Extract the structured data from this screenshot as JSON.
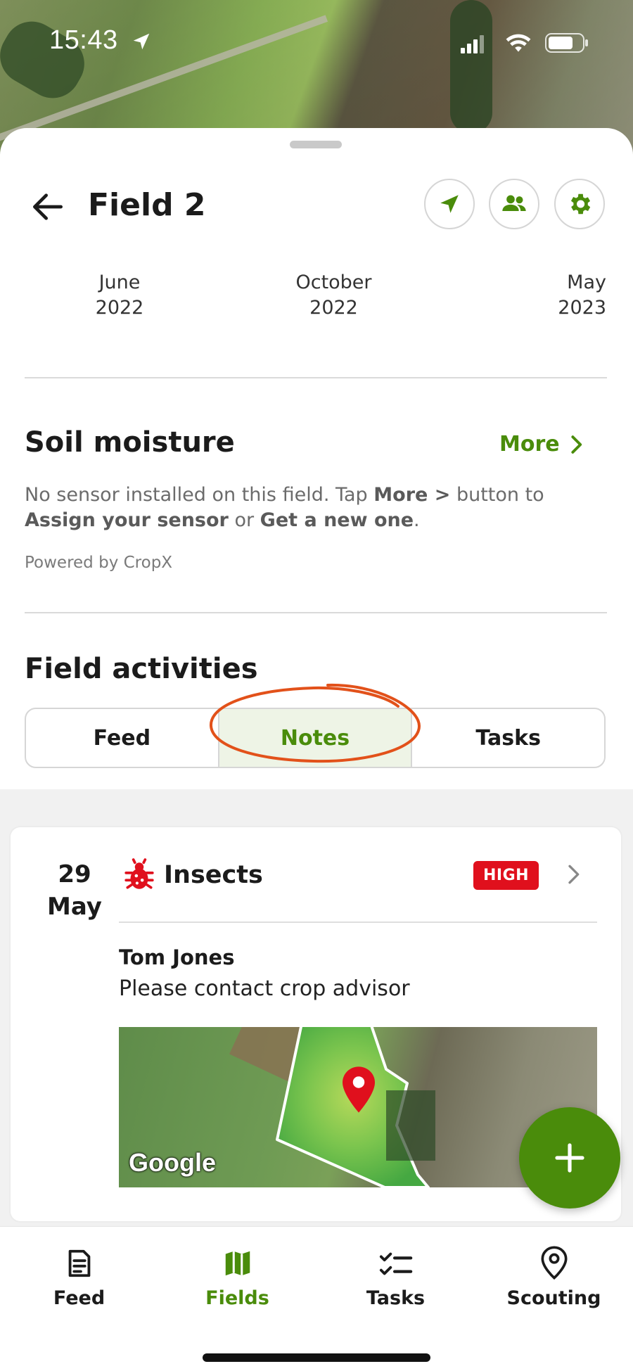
{
  "status_bar": {
    "time": "15:43"
  },
  "header": {
    "title": "Field 2",
    "icons": [
      "back-arrow-icon",
      "navigate-icon",
      "people-icon",
      "gear-icon"
    ]
  },
  "timeline": [
    {
      "month": "June",
      "year": "2022"
    },
    {
      "month": "October",
      "year": "2022"
    },
    {
      "month": "May",
      "year": "2023"
    }
  ],
  "soil_moisture": {
    "title": "Soil moisture",
    "more_label": "More",
    "text_1": "No sensor installed on this field. Tap ",
    "text_more": "More >",
    "text_2": " button to ",
    "text_assign": "Assign your sensor",
    "text_3": " or ",
    "text_get": "Get a new one",
    "text_4": ".",
    "powered": "Powered by CropX"
  },
  "field_activities": {
    "title": "Field activities",
    "tabs": [
      {
        "label": "Feed",
        "active": false
      },
      {
        "label": "Notes",
        "active": true
      },
      {
        "label": "Tasks",
        "active": false
      }
    ]
  },
  "note_card": {
    "day": "29",
    "month": "May",
    "category": "Insects",
    "priority": "HIGH",
    "author": "Tom Jones",
    "text": "Please contact crop advisor",
    "map_label": "Google"
  },
  "bottom_nav": [
    {
      "label": "Feed",
      "icon": "document-icon",
      "active": false
    },
    {
      "label": "Fields",
      "icon": "map-icon",
      "active": true
    },
    {
      "label": "Tasks",
      "icon": "checklist-icon",
      "active": false
    },
    {
      "label": "Scouting",
      "icon": "location-pin-icon",
      "active": false
    }
  ],
  "colors": {
    "accent": "#4a8c0b",
    "priority_high": "#e0101d",
    "highlight_ring": "#e2511a"
  }
}
